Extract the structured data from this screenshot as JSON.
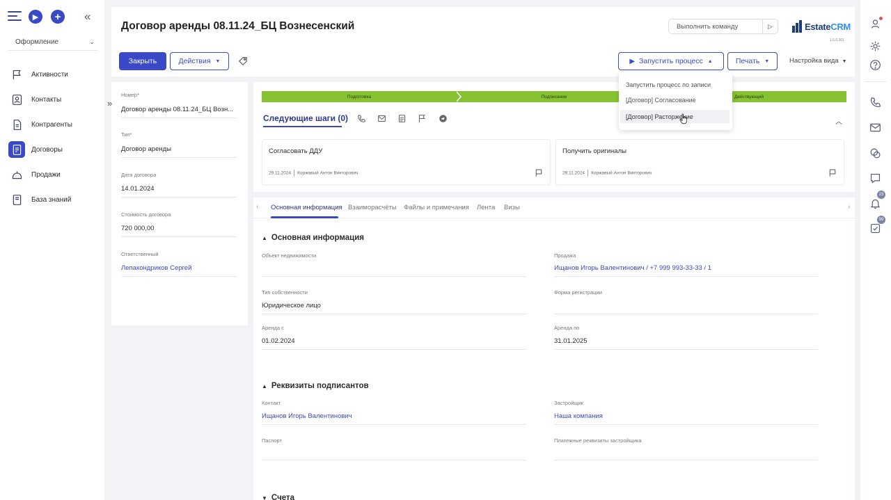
{
  "sidebar": {
    "workspace": "Оформление",
    "items": [
      {
        "label": "Активности",
        "icon": "flag-icon"
      },
      {
        "label": "Контакты",
        "icon": "contact-icon"
      },
      {
        "label": "Контрагенты",
        "icon": "document-icon"
      },
      {
        "label": "Договоры",
        "icon": "contract-icon",
        "active": true
      },
      {
        "label": "Продажи",
        "icon": "sales-icon"
      },
      {
        "label": "База знаний",
        "icon": "book-icon"
      }
    ]
  },
  "header": {
    "title": "Договор аренды 08.11.24_БЦ Вознесенский",
    "command_placeholder": "Выполнить команду",
    "logo_part1": "Estate",
    "logo_part2": "CRM",
    "version": "1.5.0.301",
    "close_label": "Закрыть",
    "actions_label": "Действия",
    "run_process_label": "Запустить процесс",
    "print_label": "Печать",
    "view_settings_label": "Настройка вида"
  },
  "dropdown": {
    "header": "Запустить процесс по записи",
    "items": [
      "[Договор] Согласование",
      "[Договор] Расторжение"
    ]
  },
  "fields": [
    {
      "label": "Номер*",
      "value": "Договор аренды 08.11.24_БЦ Возн..."
    },
    {
      "label": "Тип*",
      "value": "Договор аренды"
    },
    {
      "label": "Дата договора",
      "value": "14.01.2024"
    },
    {
      "label": "Стоимость договора",
      "value": "720 000,00"
    },
    {
      "label": "Ответственный",
      "value": "Лепакондриков Сергей"
    }
  ],
  "stages": [
    "Подготовка",
    "Подписание",
    "Действующий"
  ],
  "next_steps": {
    "title": "Следующие шаги (0)",
    "cards": [
      {
        "title": "Согласовать ДДУ",
        "date": "29.11.2024",
        "person": "Коржавый Антон Викторович"
      },
      {
        "title": "Получить оригиналы",
        "date": "29.11.2024",
        "person": "Коржавый Антон Викторович"
      }
    ]
  },
  "tabs": [
    "Основная информация",
    "Взаиморасчёты",
    "Файлы и примечания",
    "Лента",
    "Визы"
  ],
  "sections": {
    "main_title": "Основная информация",
    "main_fields": [
      {
        "label": "Объект недвижимости",
        "value": ""
      },
      {
        "label": "Продажа",
        "value": "Ищанов Игорь Валентинович / +7 999 993-33-33 / 1"
      },
      {
        "label": "Тип собственности",
        "value": "Юридическое лицо"
      },
      {
        "label": "Форма регистрации",
        "value": ""
      },
      {
        "label": "Аренда с",
        "value": "01.02.2024"
      },
      {
        "label": "Аренда по",
        "value": "31.01.2025"
      }
    ],
    "signers_title": "Реквизиты подписантов",
    "signer_fields": [
      {
        "label": "Контакт",
        "value": "Ищанов Игорь Валентинович"
      },
      {
        "label": "Застройщик",
        "value": "Наша компания"
      },
      {
        "label": "Паспорт",
        "value": ""
      },
      {
        "label": "Платежные реквизиты застройщика",
        "value": ""
      }
    ],
    "accounts_title": "Счета"
  },
  "rightbar": {
    "notifications_badge": "23",
    "tasks_badge": "99"
  },
  "colors": {
    "accent": "#3949c7",
    "stage_green": "#86c232"
  }
}
